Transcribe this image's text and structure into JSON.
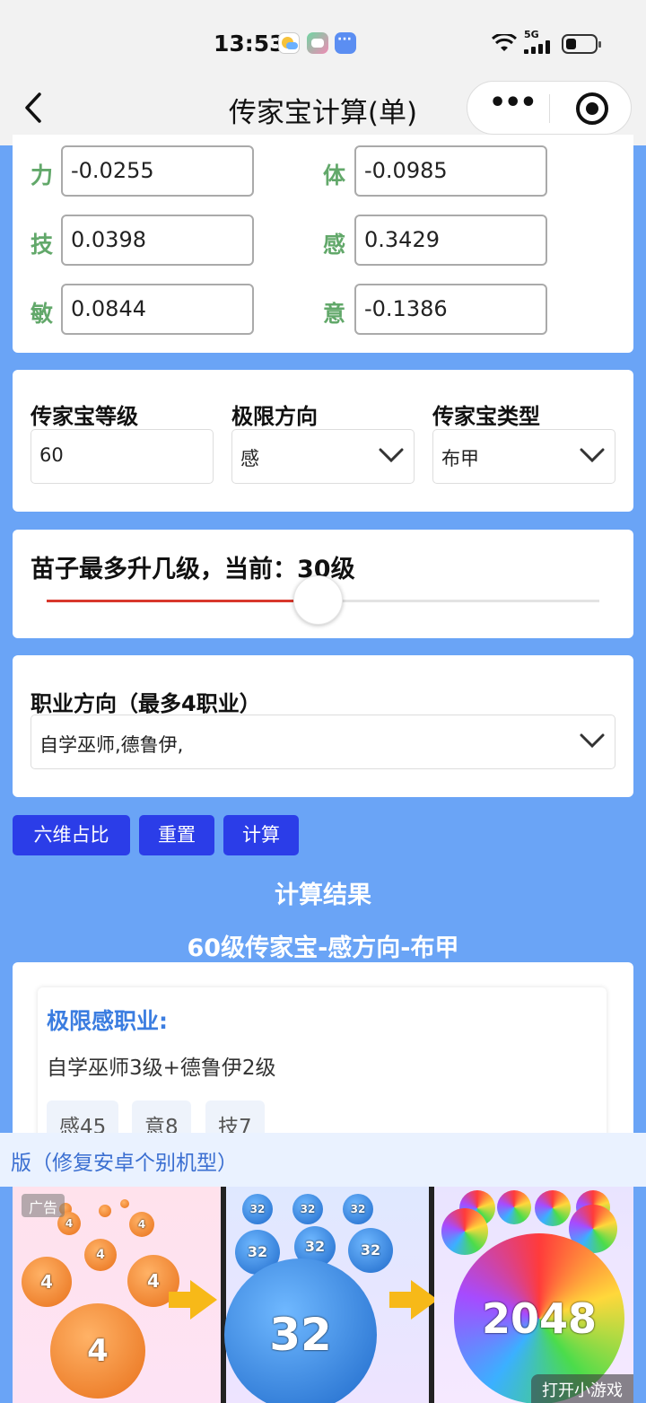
{
  "status_bar": {
    "time": "13:53",
    "network": "5G"
  },
  "nav": {
    "title": "传家宝计算(单)"
  },
  "attributes": [
    {
      "label": "力",
      "value": "-0.0255"
    },
    {
      "label": "体",
      "value": "-0.0985"
    },
    {
      "label": "技",
      "value": "0.0398"
    },
    {
      "label": "感",
      "value": "0.3429"
    },
    {
      "label": "敏",
      "value": "0.0844"
    },
    {
      "label": "意",
      "value": "-0.1386"
    }
  ],
  "settings": {
    "level_label": "传家宝等级",
    "level_value": "60",
    "direction_label": "极限方向",
    "direction_value": "感",
    "type_label": "传家宝类型",
    "type_value": "布甲"
  },
  "slider": {
    "title": "苗子最多升几级，当前：30级",
    "fraction": 0.49
  },
  "profession": {
    "label": "职业方向（最多4职业）",
    "value": "自学巫师,德鲁伊,"
  },
  "buttons": {
    "ratio": "六维占比",
    "reset": "重置",
    "calc": "计算"
  },
  "result": {
    "heading": "计算结果",
    "subheading": "60级传家宝-感方向-布甲",
    "card_title": "极限感职业:",
    "card_text": "自学巫师3级+德鲁伊2级",
    "tags": [
      "感45",
      "意8",
      "技7"
    ]
  },
  "notice": {
    "text": "版（修复安卓个别机型）"
  },
  "ad": {
    "badge": "广告",
    "open_label": "打开小游戏",
    "ball_numbers": [
      "4",
      "32",
      "2048"
    ]
  },
  "colors": {
    "page_bg": "#6aa4f6",
    "button": "#2b3de8",
    "label_green": "#62a86a",
    "accent_red": "#d8382c",
    "title_blue": "#3b7de0"
  }
}
